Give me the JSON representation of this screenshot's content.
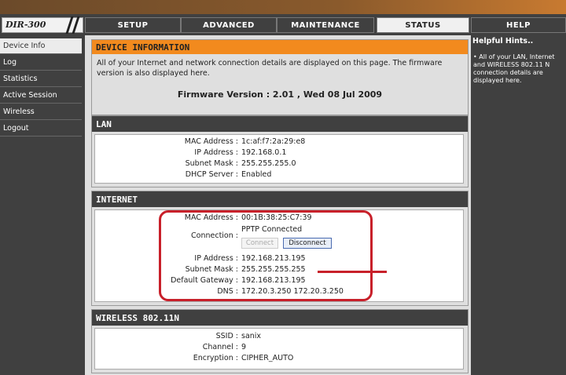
{
  "logo": {
    "text": "DIR-300"
  },
  "nav": {
    "tabs": [
      {
        "label": "SETUP"
      },
      {
        "label": "ADVANCED"
      },
      {
        "label": "MAINTENANCE"
      },
      {
        "label": "STATUS"
      },
      {
        "label": "HELP"
      }
    ]
  },
  "sidebar": {
    "items": [
      {
        "label": "Device Info"
      },
      {
        "label": "Log"
      },
      {
        "label": "Statistics"
      },
      {
        "label": "Active Session"
      },
      {
        "label": "Wireless"
      },
      {
        "label": "Logout"
      }
    ]
  },
  "device_info": {
    "title": "DEVICE INFORMATION",
    "description": "All of your Internet and network connection details are displayed on this page. The firmware version is also displayed here.",
    "firmware": "Firmware Version : 2.01 ,  Wed 08 Jul 2009"
  },
  "lan": {
    "title": "LAN",
    "mac_label": "MAC Address :",
    "mac": "1c:af:f7:2a:29:e8",
    "ip_label": "IP Address :",
    "ip": "192.168.0.1",
    "mask_label": "Subnet Mask :",
    "mask": "255.255.255.0",
    "dhcp_label": "DHCP Server :",
    "dhcp": "Enabled"
  },
  "internet": {
    "title": "INTERNET",
    "mac_label": "MAC Address :",
    "mac": "00:1B:38:25:C7:39",
    "conn_label": "Connection :",
    "conn": "PPTP  Connected",
    "connect_btn": "Connect",
    "disconnect_btn": "Disconnect",
    "ip_label": "IP Address :",
    "ip": "192.168.213.195",
    "mask_label": "Subnet Mask :",
    "mask": "255.255.255.255",
    "gw_label": "Default Gateway :",
    "gw": "192.168.213.195",
    "dns_label": "DNS :",
    "dns": "172.20.3.250 172.20.3.250"
  },
  "wireless": {
    "title": "WIRELESS 802.11N",
    "ssid_label": "SSID :",
    "ssid": "sanix",
    "channel_label": "Channel :",
    "channel": "9",
    "enc_label": "Encryption :",
    "enc": "CIPHER_AUTO"
  },
  "help": {
    "title": "Helpful Hints..",
    "text": "•  All of your LAN, Internet and WIRELESS 802.11 N connection details are displayed here."
  }
}
